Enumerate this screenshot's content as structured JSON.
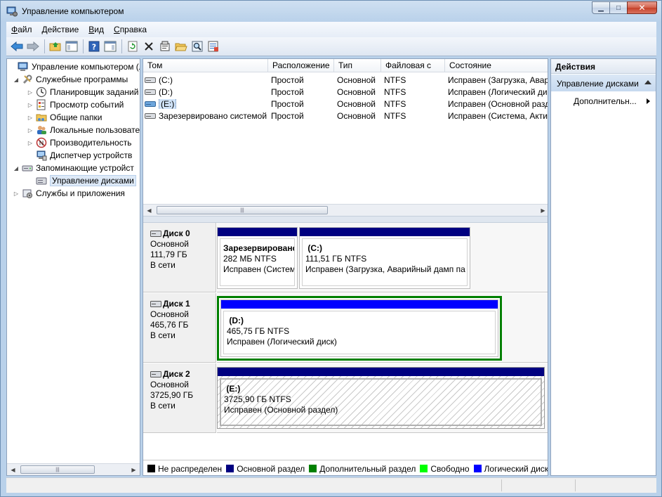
{
  "window": {
    "title": "Управление компьютером"
  },
  "menu": [
    {
      "label": "Файл",
      "key": "Ф",
      "rest": "айл"
    },
    {
      "label": "Действие",
      "key": "Д",
      "rest": "ействие"
    },
    {
      "label": "Вид",
      "key": "В",
      "rest": "ид"
    },
    {
      "label": "Справка",
      "key": "С",
      "rest": "правка"
    }
  ],
  "tree": {
    "items": [
      {
        "label": "Управление компьютером (л",
        "icon": "computer-icon"
      },
      {
        "label": "Служебные программы",
        "icon": "tools-icon"
      },
      {
        "label": "Планировщик заданий",
        "icon": "clock-icon"
      },
      {
        "label": "Просмотр событий",
        "icon": "event-viewer-icon"
      },
      {
        "label": "Общие папки",
        "icon": "shared-folder-icon"
      },
      {
        "label": "Локальные пользовате",
        "icon": "users-icon"
      },
      {
        "label": "Производительность",
        "icon": "performance-icon"
      },
      {
        "label": "Диспетчер устройств",
        "icon": "device-manager-icon"
      },
      {
        "label": "Запоминающие устройст",
        "icon": "storage-icon"
      },
      {
        "label": "Управление дисками",
        "icon": "disk-management-icon"
      },
      {
        "label": "Службы и приложения",
        "icon": "services-icon"
      }
    ]
  },
  "volumes": {
    "columns": [
      "Том",
      "Расположение",
      "Тип",
      "Файловая с",
      "Состояние"
    ],
    "rows": [
      {
        "name": "(C:)",
        "layout": "Простой",
        "type": "Основной",
        "fs": "NTFS",
        "status": "Исправен (Загрузка, Авар"
      },
      {
        "name": "(D:)",
        "layout": "Простой",
        "type": "Основной",
        "fs": "NTFS",
        "status": "Исправен (Логический диз"
      },
      {
        "name": "(E:)",
        "layout": "Простой",
        "type": "Основной",
        "fs": "NTFS",
        "status": "Исправен (Основной разд"
      },
      {
        "name": "Зарезервировано системой",
        "layout": "Простой",
        "type": "Основной",
        "fs": "NTFS",
        "status": "Исправен (Система, Акти"
      }
    ]
  },
  "disks": [
    {
      "name": "Диск 0",
      "kind": "Основной",
      "size": "111,79 ГБ",
      "state": "В сети",
      "partitions": [
        {
          "label": "Зарезервированс",
          "size": "282 МБ NTFS",
          "status": "Исправен (Систем"
        },
        {
          "label": "(C:)",
          "size": "111,51 ГБ NTFS",
          "status": "Исправен (Загрузка, Аварийный дамп па"
        }
      ]
    },
    {
      "name": "Диск 1",
      "kind": "Основной",
      "size": "465,76 ГБ",
      "state": "В сети",
      "partitions": [
        {
          "label": "(D:)",
          "size": "465,75 ГБ NTFS",
          "status": "Исправен (Логический диск)"
        }
      ]
    },
    {
      "name": "Диск 2",
      "kind": "Основной",
      "size": "3725,90 ГБ",
      "state": "В сети",
      "partitions": [
        {
          "label": "(E:)",
          "size": "3725,90 ГБ NTFS",
          "status": "Исправен (Основной раздел)"
        }
      ]
    }
  ],
  "legend": [
    {
      "label": "Не распределен",
      "color": "#000000"
    },
    {
      "label": "Основной раздел",
      "color": "#000080"
    },
    {
      "label": "Дополнительный раздел",
      "color": "#008000"
    },
    {
      "label": "Свободно",
      "color": "#00ff00"
    },
    {
      "label": "Логический диск",
      "color": "#0000ff"
    }
  ],
  "actions": {
    "header": "Действия",
    "section": "Управление дисками",
    "more": "Дополнительн..."
  },
  "colors": {
    "primary_partition": "#000080",
    "logical_drive": "#0000ff",
    "extended_partition": "#008000"
  }
}
